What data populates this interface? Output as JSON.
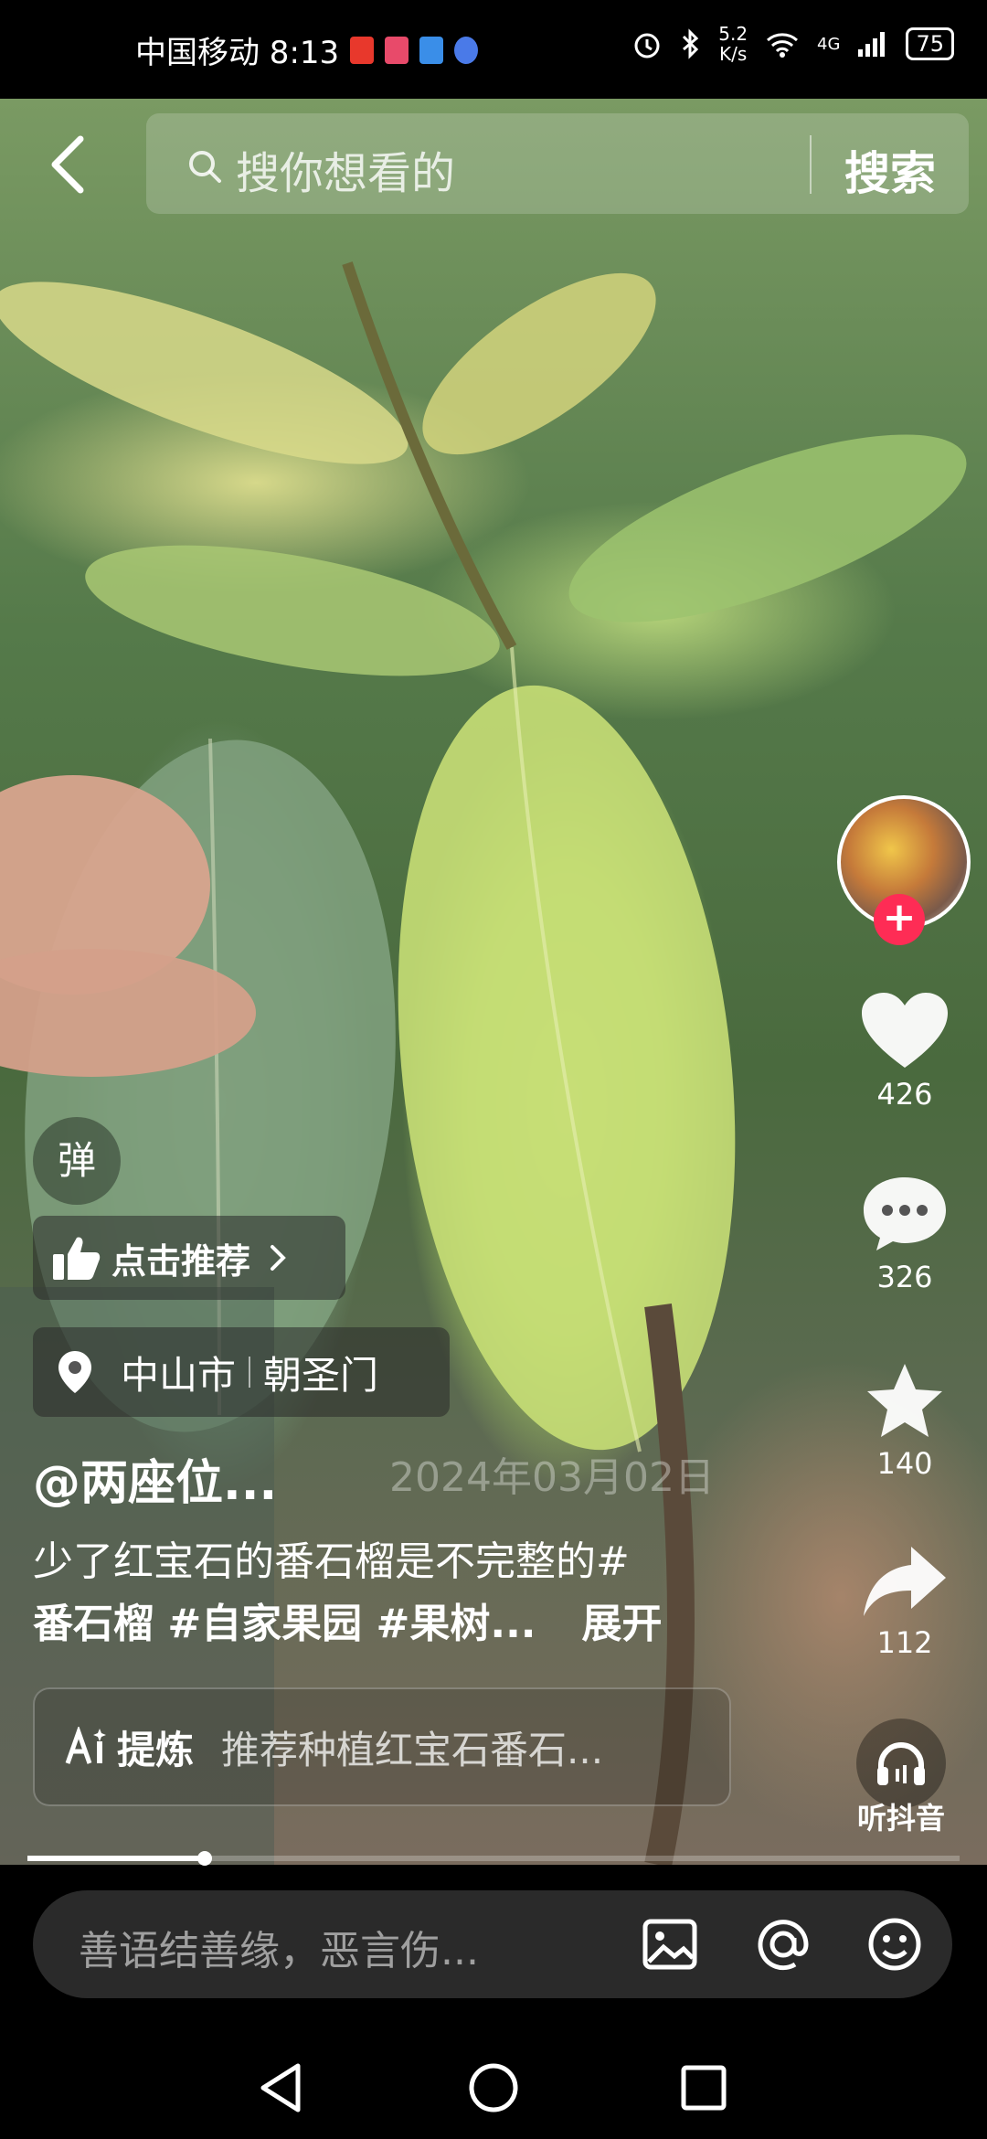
{
  "status_bar": {
    "carrier_time": "中国移动 8:13",
    "net_speed_value": "5.2",
    "net_speed_unit": "K/s",
    "network_type": "4G",
    "battery": "75"
  },
  "search": {
    "placeholder": "搜你想看的",
    "button": "搜索"
  },
  "sidebar": {
    "likes": "426",
    "comments": "326",
    "favorites": "140",
    "shares": "112",
    "listen_label": "听抖音"
  },
  "danmu_label": "弹",
  "recommend_label": "点击推荐",
  "location": {
    "city": "中山市",
    "place": "朝圣门"
  },
  "post": {
    "author": "@两座位...",
    "date_watermark": "2024年03月02日",
    "caption_line1": "少了红宝石的番石榴是不完整的#",
    "caption_line2": "番石榴 #自家果园 #果树...",
    "expand": "展开"
  },
  "refine": {
    "label": "提炼",
    "text": "推荐种植红宝石番石..."
  },
  "progress": 0.19,
  "comment_input": {
    "placeholder": "善语结善缘，恶言伤..."
  },
  "colors": {
    "accent_red": "#fe2c55",
    "bar_bg": "#2a2a2a"
  }
}
